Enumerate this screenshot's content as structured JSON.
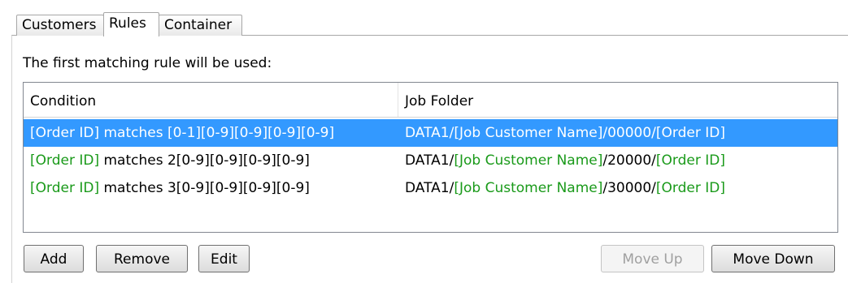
{
  "tabs": [
    {
      "label": "Customers",
      "active": false
    },
    {
      "label": "Rules",
      "active": true
    },
    {
      "label": "Container",
      "active": false
    }
  ],
  "intro_text": "The first matching rule will be used:",
  "table": {
    "columns": [
      "Condition",
      "Job Folder"
    ],
    "rows": [
      {
        "selected": true,
        "condition": {
          "token": "[Order ID]",
          "text": " matches [0-1][0-9][0-9][0-9][0-9]"
        },
        "folder": {
          "p1": "DATA1/",
          "t1": "[Job Customer Name]",
          "p2": "/00000/",
          "t2": "[Order ID]"
        }
      },
      {
        "selected": false,
        "condition": {
          "token": "[Order ID]",
          "text": " matches 2[0-9][0-9][0-9][0-9]"
        },
        "folder": {
          "p1": "DATA1/",
          "t1": "[Job Customer Name]",
          "p2": "/20000/",
          "t2": "[Order ID]"
        }
      },
      {
        "selected": false,
        "condition": {
          "token": "[Order ID]",
          "text": " matches 3[0-9][0-9][0-9][0-9]"
        },
        "folder": {
          "p1": "DATA1/",
          "t1": "[Job Customer Name]",
          "p2": "/30000/",
          "t2": "[Order ID]"
        }
      }
    ]
  },
  "buttons": {
    "add": "Add",
    "remove": "Remove",
    "edit": "Edit",
    "move_up": "Move Up",
    "move_up_enabled": false,
    "move_down": "Move Down"
  },
  "colors": {
    "selection": "#3399ff",
    "token_green": "#1a9a1a"
  }
}
